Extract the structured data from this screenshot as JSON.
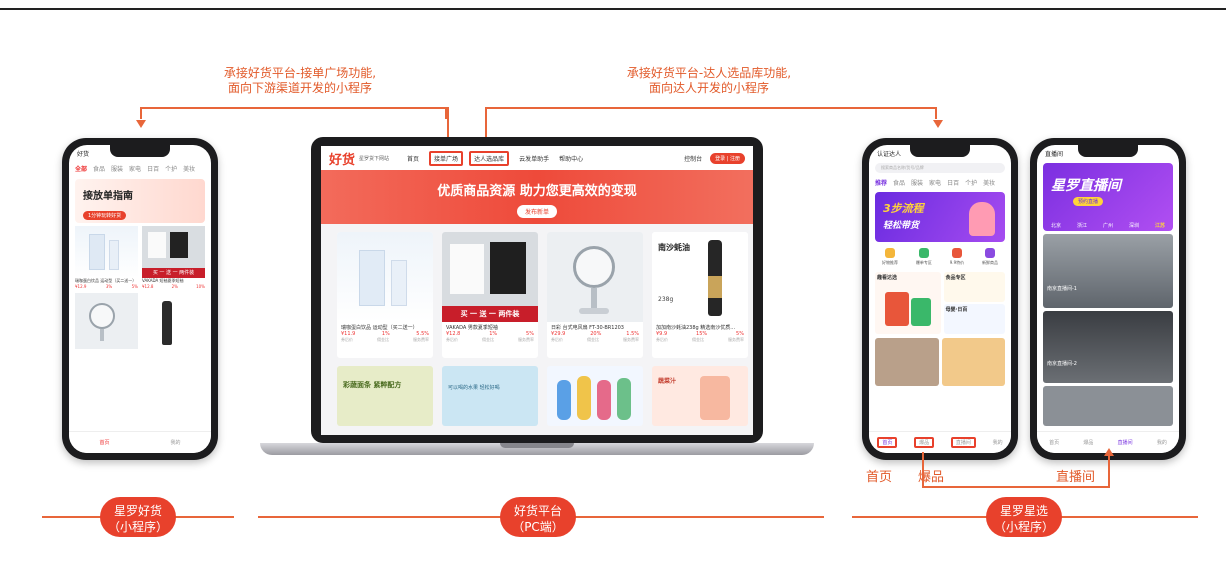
{
  "annotations": {
    "left_line1": "承接好货平台-接单广场功能,",
    "left_line2": "面向下游渠道开发的小程序",
    "right_line1": "承接好货平台-达人选品库功能,",
    "right_line2": "面向达人开发的小程序"
  },
  "phone1": {
    "title": "好货",
    "tabs": [
      "全部",
      "食品",
      "服装",
      "家电",
      "日百",
      "个护",
      "美妆"
    ],
    "banner_title": "接放单指南",
    "banner_sub": "1分钟玩转好货",
    "products": [
      {
        "title": "瑞咖蛋白饮品 运动型（买二送一）",
        "price": "¥12.9",
        "rate": "3%",
        "fee": "5%"
      },
      {
        "title": "VAKADA 短袖夏季短袖",
        "price": "¥12.8",
        "rate": "2%",
        "fee": "10%"
      }
    ],
    "promo": "买 一 送 一   两件装",
    "tab_home": "首页",
    "tab_mine": "我的"
  },
  "pc": {
    "logo": "好货",
    "site_name": "星罗货下网站",
    "nav": [
      "首页",
      "接单广场",
      "达人选品库",
      "云发单助手",
      "帮助中心"
    ],
    "right_nav": "控制台",
    "login": "登录 | 注册",
    "hero": "优质商品资源  助力您更高效的变现",
    "hero_btn": "发布新单",
    "products": [
      {
        "title": "瑞咖蛋白饮品 运动型（买二送一）",
        "price": "¥11.9",
        "rate": "1%",
        "fee": "5.5%"
      },
      {
        "title": "VAKADA 男款夏季短袖",
        "price": "¥12.8",
        "rate": "1%",
        "fee": "5%"
      },
      {
        "title": "日彩 台式电风扇 FT-30-BR1203",
        "price": "¥29.9",
        "rate": "20%",
        "fee": "1.5%"
      },
      {
        "title": "加加南沙蚝油238g 精选南沙优质...",
        "price": "¥9.9",
        "rate": "15%",
        "fee": "5%"
      }
    ],
    "stat_labels": [
      "券后价",
      "佣金比",
      "服务费率"
    ],
    "promo": "买 一 送 一   两件装",
    "oyster_name": "南沙蚝油",
    "oyster_weight": "238g",
    "fresh_text": "彩蔬面条 紧粹配方",
    "fresh_sub": "可以喝的水果 轻松好喝",
    "juice_text": "蔬菜汁"
  },
  "phone3": {
    "title": "认证达人",
    "search_placeholder": "搜索商品名称/货号/品牌",
    "tabs": [
      "推荐",
      "食品",
      "服装",
      "家电",
      "日百",
      "个护",
      "美妆"
    ],
    "banner_big": "3步流程",
    "banner_sub": "轻松带货",
    "icons": [
      "好物推荐",
      "爆单专区",
      "9.9特价",
      "新鲜商品"
    ],
    "section1": "趣看达选",
    "section2": "食品专区",
    "section3": "母婴·日百",
    "tabbar": [
      "首页",
      "爆品",
      "直播间",
      "我的"
    ]
  },
  "phone4": {
    "title": "直播间",
    "banner": "星罗直播间",
    "banner_btn": "预约直播",
    "cities": [
      "北京",
      "浙江",
      "广州",
      "深圳",
      "江苏"
    ],
    "rooms": [
      "南京直播间-1",
      "南京直播间-2"
    ],
    "tabbar": [
      "首页",
      "爆品",
      "直播间",
      "我的"
    ]
  },
  "labels": {
    "home": "首页",
    "hot": "爆品",
    "live": "直播间"
  },
  "ribbons": {
    "left_line1": "星罗好货",
    "left_line2": "（小程序）",
    "mid_line1": "好货平台",
    "mid_line2": "（PC端）",
    "right_line1": "星罗星选",
    "right_line2": "（小程序）"
  },
  "colors": {
    "accent": "#e8412c",
    "connector": "#e8663a"
  }
}
